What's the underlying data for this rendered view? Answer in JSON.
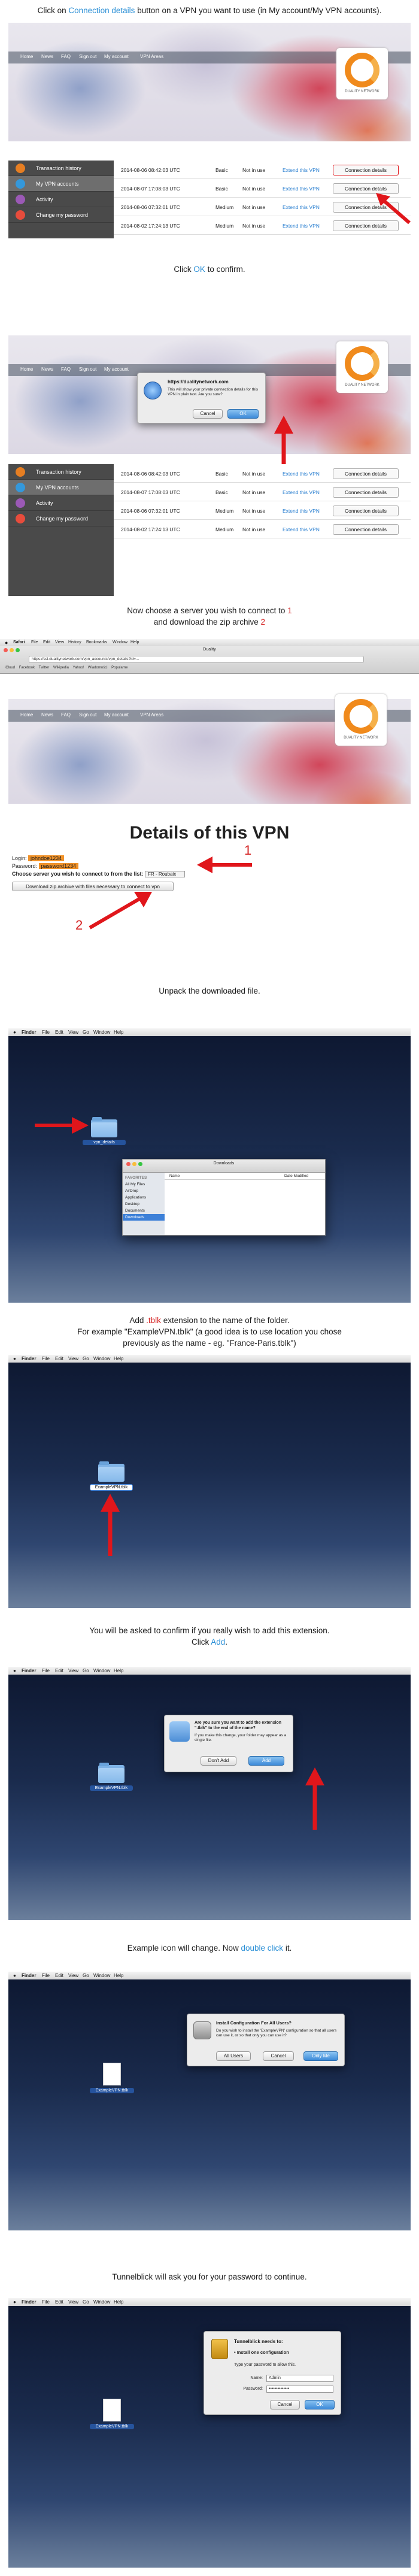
{
  "captions": {
    "c1a": "Click on ",
    "c1b": "Connection details",
    "c1c": " button on a VPN you want to use (in My account/My VPN accounts).",
    "c2a": "Click ",
    "c2b": "OK",
    "c2c": " to confirm.",
    "c3a": "Now choose a server you wish to connect to ",
    "c3b": "1",
    "c3c": "and download the zip archive ",
    "c3d": "2",
    "c4": "Unpack the downloaded file.",
    "c5a": "Add ",
    "c5b": ".tblk",
    "c5c": " extension to the name of the folder.",
    "c5d": "For example \"ExampleVPN.tblk\" (a good idea is to use location you chose",
    "c5e": "previously as the name - eg. \"France-Paris.tblk\")",
    "c6a": "You will be asked to confirm if you really wish to add this extension.",
    "c6b": "Click ",
    "c6c": "Add",
    "c6d": ".",
    "c7a": "Example icon will change. Now ",
    "c7b": "double click",
    "c7c": " it.",
    "c8": "Tunnelblick will ask you for your password to continue."
  },
  "site": {
    "nav": [
      "Home",
      "News",
      "FAQ",
      "Sign out",
      "My account",
      "VPN Areas"
    ],
    "logo_text": "DUALITY NETWORK",
    "sidebar": [
      "Transaction history",
      "My VPN accounts",
      "Activity",
      "Change my password"
    ],
    "accounts": [
      {
        "date": "2014-08-06 08:42:03 UTC",
        "plan": "Basic",
        "status": "Not in use",
        "action": "Extend this VPN",
        "button": "Connection details"
      },
      {
        "date": "2014-08-07 17:08:03 UTC",
        "plan": "Basic",
        "status": "Not in use",
        "action": "Extend this VPN",
        "button": "Connection details"
      },
      {
        "date": "2014-08-06 07:32:01 UTC",
        "plan": "Medium",
        "status": "Not in use",
        "action": "Extend this VPN",
        "button": "Connection details"
      },
      {
        "date": "2014-08-02 17:24:13 UTC",
        "plan": "Medium",
        "status": "Not in use",
        "action": "Extend this VPN",
        "button": "Connection details"
      }
    ]
  },
  "confirm_dialog": {
    "title": "https://dualitynetwork.com",
    "message": "This will show your private connection details for this VPN in plain text. Are you sure?",
    "cancel": "Cancel",
    "ok": "OK"
  },
  "browser": {
    "menu": [
      "Safari",
      "File",
      "Edit",
      "View",
      "History",
      "Bookmarks",
      "Window",
      "Help"
    ],
    "title": "Duality",
    "url": "https://ssl.dualitynetwork.com/vpn_accounts/vpn_details?id=...",
    "bookmarks": [
      "iCloud",
      "Facebook",
      "Twitter",
      "Wikipedia",
      "Yahoo!",
      "Wiadomości",
      "Popularne"
    ]
  },
  "details": {
    "heading": "Details of this VPN",
    "login_label": "Login:",
    "login_value": "johndoe1234",
    "password_label": "Password:",
    "password_value": "password1234",
    "server_label": "Choose server you wish to connect to from the list:",
    "server_value": "FR - Roubaix",
    "download_button": "Download zip archive with files necessary to connect to vpn",
    "marker1": "1",
    "marker2": "2"
  },
  "finder": {
    "menu": [
      "Finder",
      "File",
      "Edit",
      "View",
      "Go",
      "Window",
      "Help"
    ],
    "folder_name": "vpn_details",
    "folder_renamed": "ExampleVPN.tblk",
    "window_title": "Downloads",
    "favorites_header": "FAVORITES",
    "favorites": [
      "All My Files",
      "AirDrop",
      "Applications",
      "Desktop",
      "Documents",
      "Downloads"
    ],
    "columns": [
      "Name",
      "Date Modified"
    ]
  },
  "rename_dialog": {
    "title": "Are you sure you want to add the extension \".tblk\" to the end of the name?",
    "message": "If you make this change, your folder may appear as a single file.",
    "dont_add": "Don't Add",
    "add": "Add"
  },
  "install_dialog": {
    "title": "Install Configuration For All Users?",
    "message": "Do you wish to install the 'ExampleVPN' configuration so that all users can use it, or so that only you can use it?",
    "all_users": "All Users",
    "cancel": "Cancel",
    "only_me": "Only Me"
  },
  "password_dialog": {
    "title": "Tunnelblick needs to:",
    "bullet": "Install one configuration",
    "prompt": "Type your password to allow this.",
    "name_label": "Name:",
    "name_value": "Admin",
    "password_label": "Password:",
    "password_value": "••••••••••••••",
    "cancel": "Cancel",
    "ok": "OK"
  }
}
